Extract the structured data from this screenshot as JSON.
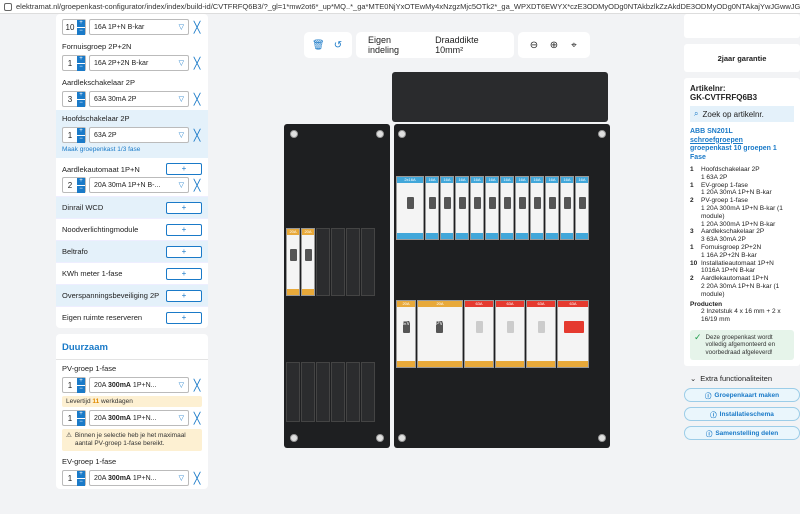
{
  "browser": {
    "url": "elektramat.nl/groepenkast-configurator/index/index/build-id/CVTFRFQ6B3/?_gl=1*mw2ot6*_up*MQ..*_ga*MTE0NjYxOTEwMy4xNzgzMjc5OTk2*_ga_WPXDT6EWYX*czE3ODMyODg0NTAkbzlkZzAkdDE3ODMyODg0NTAkajYwJGwwJGgxMDQ4MjI..."
  },
  "left": {
    "items": [
      {
        "label": "",
        "qty": "10",
        "value": "16A 1P+N B-kar"
      },
      {
        "label": "Fornuisgroep 2P+2N",
        "qty": "1",
        "value": "16A 2P+2N B-kar"
      },
      {
        "label": "Aardlekschakelaar 2P",
        "qty": "3",
        "value": "63A 30mA 2P"
      },
      {
        "label": "Hoofdschakelaar 2P",
        "qty": "1",
        "value": "63A 2P",
        "link": "Maak groepenkast 1/3 fase"
      },
      {
        "label": "Aardlekautomaat 1P+N",
        "qty": "2",
        "value": "20A 30mA 1P+N B-..."
      }
    ],
    "addon_rows": [
      "Dinrail WCD",
      "Noodverlichtingmodule",
      "Beltrafo",
      "KWh meter 1-fase",
      "Overspanningsbeveiliging 2P",
      "Eigen ruimte reserveren"
    ],
    "add_label": "+",
    "remove_label": "╳",
    "chevron": "▽",
    "plus": "+",
    "minus": "−",
    "durable": {
      "title": "Duurzaam",
      "pv_label": "PV-groep 1-fase",
      "pv1": {
        "qty": "1",
        "value_pre": "20A ",
        "value_b": "300mA",
        "value_post": " 1P+N..."
      },
      "lead_pre": "Levertijd ",
      "lead_days": "11",
      "lead_post": " werkdagen",
      "pv2": {
        "qty": "1",
        "value_pre": "20A ",
        "value_b": "300mA",
        "value_post": " 1P+N..."
      },
      "warning": "Binnen je selectie heb je het maximaal aantal PV-groep 1-fase bereikt.",
      "ev_label": "EV-groep 1-fase",
      "ev": {
        "qty": "1",
        "value_pre": "20A ",
        "value_b": "300mA",
        "value_post": " 1P+N..."
      }
    }
  },
  "toolbar": {
    "layout_label": "Eigen indeling",
    "wire_label": "Draaddikte 10mm²"
  },
  "right": {
    "guarantee": "2jaar garantie",
    "article_label": "Artikelnr:",
    "article_code": "GK-CVTFRFQ6B3",
    "search_label": "Zoek op artikelnr.",
    "product_title_1": "ABB SN201L",
    "product_title_2": "schroefgroepen",
    "product_title_3": "groepenkast 10 groepen 1 Fase",
    "spec": [
      {
        "n": "1",
        "t": "Hoofdschakelaar 2P",
        "sub": "1 63A 2P"
      },
      {
        "n": "1",
        "t": "EV-groep 1-fase",
        "sub": "1 20A 30mA 1P+N B-kar"
      },
      {
        "n": "2",
        "t": "PV-groep 1-fase",
        "sub": "1 20A 300mA 1P+N B-kar (1 module)",
        "sub2": "1 20A 300mA 1P+N B-kar"
      },
      {
        "n": "3",
        "t": "Aardlekschakelaar 2P",
        "sub": "3 63A 30mA 2P"
      },
      {
        "n": "1",
        "t": "Fornuisgroep 2P+2N",
        "sub": "1 16A 2P+2N B-kar"
      },
      {
        "n": "10",
        "t": "Installatieautomaat 1P+N",
        "sub": "1016A 1P+N B-kar"
      },
      {
        "n": "2",
        "t": "Aardlekautomaat 1P+N",
        "sub": "2 20A 30mA 1P+N B-kar (1 module)"
      }
    ],
    "products_head": "Producten",
    "products_line": "2 Inzetstuk 4 x 16 mm + 2 x 16/19 mm",
    "ok_text": "Deze groepenkast wordt volledig afgemonteerd en voorbedraad afgeleverd!",
    "extra_label": "Extra functionaliteiten",
    "btn_make": "Groepenkaart maken",
    "btn_schema": "Installatieschema",
    "btn_comp": "Samenstelling delen"
  },
  "board": {
    "left_top_labels": [
      "20A",
      "20A"
    ],
    "right_top_labels": [
      "2x16A",
      "16A",
      "16A",
      "16A",
      "16A",
      "16A",
      "16A",
      "16A",
      "16A",
      "16A",
      "16A",
      "16A"
    ],
    "bottom_top_labels": [
      "20A",
      "20A",
      "63A",
      "63A",
      "63A",
      "63A",
      "63A"
    ],
    "ev_tag": "EV",
    "pv_tag": "PV"
  }
}
